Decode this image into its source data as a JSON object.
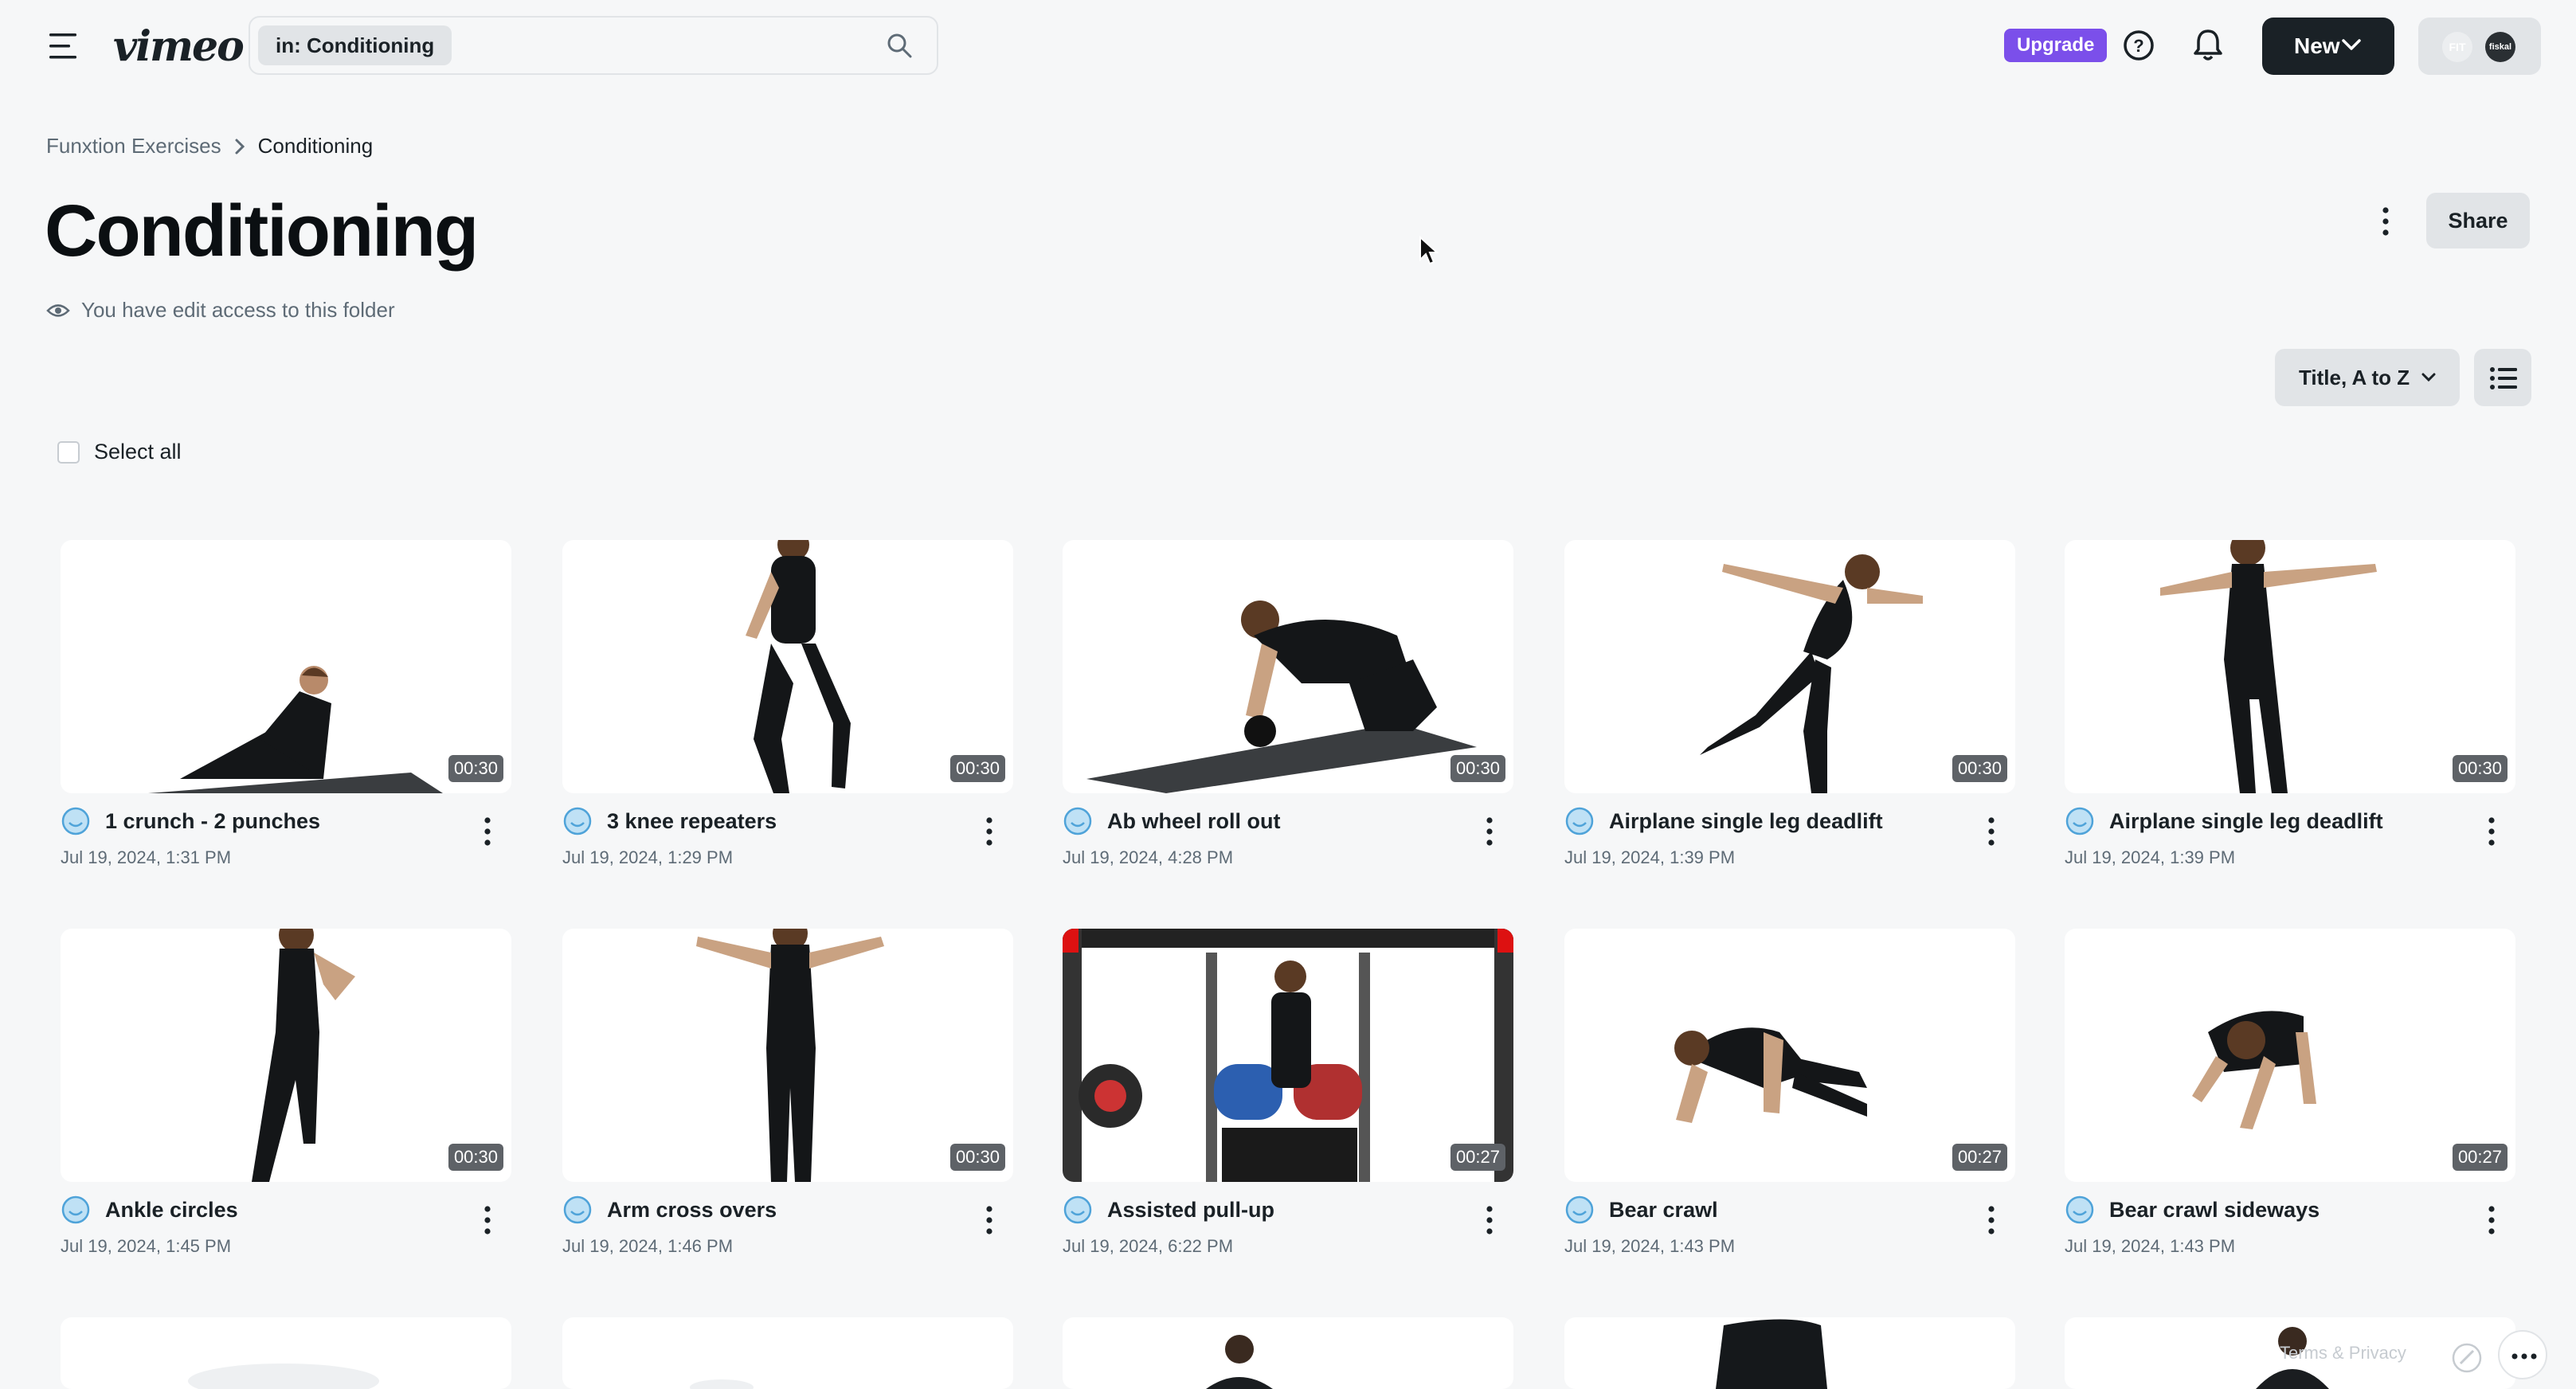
{
  "header": {
    "logo": "vimeo",
    "search": {
      "chip": "in: Conditioning",
      "placeholder": ""
    },
    "upgrade_label": "Upgrade",
    "new_label": "New",
    "account": {
      "avatar1": "FIT",
      "avatar2": "fiskal"
    }
  },
  "breadcrumb": {
    "parent": "Funxtion Exercises",
    "current": "Conditioning"
  },
  "page": {
    "title": "Conditioning",
    "access_text": "You have edit access to this folder",
    "share_label": "Share",
    "sort_label": "Title, A to Z",
    "select_all_label": "Select all"
  },
  "videos": [
    {
      "title": "1 crunch - 2 punches",
      "date": "Jul 19, 2024, 1:31 PM",
      "duration": "00:30"
    },
    {
      "title": "3 knee repeaters",
      "date": "Jul 19, 2024, 1:29 PM",
      "duration": "00:30"
    },
    {
      "title": "Ab wheel roll out",
      "date": "Jul 19, 2024, 4:28 PM",
      "duration": "00:30"
    },
    {
      "title": "Airplane single leg deadlift",
      "date": "Jul 19, 2024, 1:39 PM",
      "duration": "00:30"
    },
    {
      "title": "Airplane single leg deadlift",
      "date": "Jul 19, 2024, 1:39 PM",
      "duration": "00:30"
    },
    {
      "title": "Ankle circles",
      "date": "Jul 19, 2024, 1:45 PM",
      "duration": "00:30"
    },
    {
      "title": "Arm cross overs",
      "date": "Jul 19, 2024, 1:46 PM",
      "duration": "00:30"
    },
    {
      "title": "Assisted pull-up",
      "date": "Jul 19, 2024, 6:22 PM",
      "duration": "00:27"
    },
    {
      "title": "Bear crawl",
      "date": "Jul 19, 2024, 1:43 PM",
      "duration": "00:27"
    },
    {
      "title": "Bear crawl sideways",
      "date": "Jul 19, 2024, 1:43 PM",
      "duration": "00:27"
    }
  ],
  "footer": {
    "terms": "Terms & Privacy"
  },
  "icons": [
    "menu-icon",
    "search-icon",
    "help-icon",
    "bell-icon",
    "chevron-down-icon",
    "chevron-right-icon",
    "eye-icon",
    "kebab-icon",
    "list-view-icon",
    "video-status-icon",
    "more-horizontal-icon"
  ],
  "colors": {
    "accent": "#7b4fea",
    "primary_button": "#1a2126",
    "background": "#f6f7f8",
    "status_icon": "#4fa3d9"
  }
}
